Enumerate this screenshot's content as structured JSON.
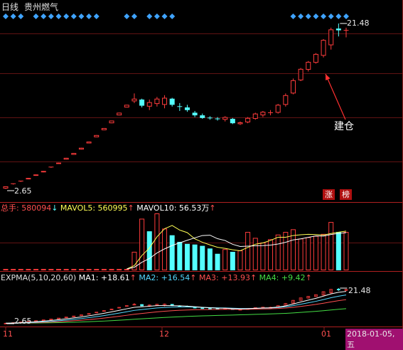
{
  "header": {
    "period": "日线",
    "stock_name": "贵州燃气"
  },
  "price_panel": {
    "high_label": "21.48",
    "low_label": "2.65",
    "annotation": "建仓",
    "badges": [
      "涨",
      "榜"
    ]
  },
  "volume_panel": {
    "label_main": "总手: 580094",
    "arrow_main": "↓",
    "mavol5": "MAVOL5: 560995",
    "arrow_mavol5": "↑",
    "mavol10": "MAVOL10: 56.53万",
    "arrow_mavol10": "↑"
  },
  "expma_panel": {
    "title": "EXPMA(5,10,20,60)",
    "ma1": "MA1: +18.61",
    "ma1_arrow": "↑",
    "ma2": "MA2: +16.54",
    "ma2_arrow": "↑",
    "ma3": "MA3: +13.93",
    "ma3_arrow": "↑",
    "ma4": "MA4: +9.42",
    "ma4_arrow": "↑",
    "high_label": "21.48",
    "low_label": "2.65"
  },
  "x_axis": {
    "labels": [
      "11",
      "12",
      "01"
    ],
    "current_date": "2018-01-05,五"
  },
  "colors": {
    "up": "#ff3c3c",
    "down": "#54ffff",
    "grid": "#8a1b1b",
    "diamond": "#3fa3ff",
    "white_line": "#ffffff",
    "yellow_line": "#ffff55",
    "mavol5": "#ffff55",
    "mavol10": "#ffffff",
    "ma1": "#ffffff",
    "ma2": "#54d8ff",
    "ma3": "#ff5050",
    "ma4": "#44dd44"
  },
  "chart_data": {
    "type": "candlestick",
    "price_range": [
      2.65,
      21.48
    ],
    "candles": [
      {
        "o": 2.65,
        "h": 2.9,
        "l": 2.6,
        "c": 2.9,
        "up": true
      },
      {
        "o": 3.1,
        "h": 3.2,
        "l": 3.1,
        "c": 3.2,
        "up": true
      },
      {
        "o": 3.4,
        "h": 3.5,
        "l": 3.4,
        "c": 3.5,
        "up": true
      },
      {
        "o": 3.7,
        "h": 3.85,
        "l": 3.7,
        "c": 3.85,
        "up": true
      },
      {
        "o": 4.1,
        "h": 4.25,
        "l": 4.1,
        "c": 4.25,
        "up": true
      },
      {
        "o": 4.5,
        "h": 4.65,
        "l": 4.5,
        "c": 4.65,
        "up": true
      },
      {
        "o": 5.0,
        "h": 5.1,
        "l": 5.0,
        "c": 5.1,
        "up": true
      },
      {
        "o": 5.45,
        "h": 5.6,
        "l": 5.45,
        "c": 5.6,
        "up": true
      },
      {
        "o": 5.95,
        "h": 6.15,
        "l": 5.95,
        "c": 6.15,
        "up": true
      },
      {
        "o": 6.5,
        "h": 6.7,
        "l": 6.5,
        "c": 6.7,
        "up": true
      },
      {
        "o": 7.1,
        "h": 7.3,
        "l": 7.1,
        "c": 7.3,
        "up": true
      },
      {
        "o": 7.8,
        "h": 8.0,
        "l": 7.8,
        "c": 8.0,
        "up": true
      },
      {
        "o": 8.5,
        "h": 8.75,
        "l": 8.5,
        "c": 8.75,
        "up": true
      },
      {
        "o": 9.3,
        "h": 9.55,
        "l": 9.3,
        "c": 9.55,
        "up": true
      },
      {
        "o": 10.1,
        "h": 10.4,
        "l": 10.1,
        "c": 10.4,
        "up": true
      },
      {
        "o": 11.0,
        "h": 11.3,
        "l": 11.0,
        "c": 11.3,
        "up": true
      },
      {
        "o": 11.9,
        "h": 12.2,
        "l": 11.9,
        "c": 12.2,
        "up": true
      },
      {
        "o": 12.6,
        "h": 13.5,
        "l": 12.4,
        "c": 12.9,
        "up": true
      },
      {
        "o": 12.8,
        "h": 12.9,
        "l": 11.9,
        "c": 12.1,
        "up": false
      },
      {
        "o": 12.0,
        "h": 12.8,
        "l": 11.6,
        "c": 12.5,
        "up": true
      },
      {
        "o": 12.3,
        "h": 13.1,
        "l": 12.0,
        "c": 12.9,
        "up": true
      },
      {
        "o": 13.0,
        "h": 13.3,
        "l": 11.8,
        "c": 12.2,
        "up": true
      },
      {
        "o": 12.9,
        "h": 13.0,
        "l": 12.0,
        "c": 12.2,
        "up": false
      },
      {
        "o": 12.0,
        "h": 12.4,
        "l": 11.5,
        "c": 11.9,
        "up": false
      },
      {
        "o": 11.9,
        "h": 12.2,
        "l": 11.4,
        "c": 11.6,
        "up": false
      },
      {
        "o": 11.3,
        "h": 11.5,
        "l": 10.8,
        "c": 11.0,
        "up": false
      },
      {
        "o": 11.0,
        "h": 11.2,
        "l": 10.6,
        "c": 10.7,
        "up": false
      },
      {
        "o": 10.7,
        "h": 10.9,
        "l": 10.5,
        "c": 10.6,
        "up": false
      },
      {
        "o": 10.6,
        "h": 10.8,
        "l": 10.4,
        "c": 10.5,
        "up": false
      },
      {
        "o": 10.5,
        "h": 10.9,
        "l": 10.3,
        "c": 10.8,
        "up": true
      },
      {
        "o": 10.6,
        "h": 10.7,
        "l": 10.0,
        "c": 10.1,
        "up": false
      },
      {
        "o": 10.0,
        "h": 10.3,
        "l": 9.9,
        "c": 10.2,
        "up": true
      },
      {
        "o": 10.2,
        "h": 10.8,
        "l": 10.1,
        "c": 10.7,
        "up": true
      },
      {
        "o": 10.6,
        "h": 11.3,
        "l": 10.5,
        "c": 11.2,
        "up": true
      },
      {
        "o": 11.0,
        "h": 11.5,
        "l": 10.8,
        "c": 11.4,
        "up": true
      },
      {
        "o": 11.2,
        "h": 11.6,
        "l": 11.0,
        "c": 11.3,
        "up": true
      },
      {
        "o": 11.3,
        "h": 12.3,
        "l": 11.2,
        "c": 12.2,
        "up": true
      },
      {
        "o": 12.2,
        "h": 13.5,
        "l": 12.0,
        "c": 13.3,
        "up": true
      },
      {
        "o": 13.5,
        "h": 15.2,
        "l": 13.4,
        "c": 15.0,
        "up": true
      },
      {
        "o": 15.0,
        "h": 16.4,
        "l": 14.9,
        "c": 16.3,
        "up": true
      },
      {
        "o": 16.2,
        "h": 17.2,
        "l": 16.0,
        "c": 17.1,
        "up": true
      },
      {
        "o": 17.0,
        "h": 18.1,
        "l": 16.9,
        "c": 18.0,
        "up": true
      },
      {
        "o": 17.8,
        "h": 19.7,
        "l": 17.6,
        "c": 19.6,
        "up": true
      },
      {
        "o": 19.0,
        "h": 21.0,
        "l": 18.5,
        "c": 20.8,
        "up": true
      },
      {
        "o": 20.7,
        "h": 21.48,
        "l": 20.0,
        "c": 20.9,
        "up": false
      },
      {
        "o": 20.6,
        "h": 21.0,
        "l": 19.9,
        "c": 20.7,
        "up": true
      }
    ],
    "volume": [
      {
        "v": 2,
        "up": true
      },
      {
        "v": 2,
        "up": true
      },
      {
        "v": 2,
        "up": true
      },
      {
        "v": 2,
        "up": true
      },
      {
        "v": 2,
        "up": true
      },
      {
        "v": 2,
        "up": true
      },
      {
        "v": 2,
        "up": true
      },
      {
        "v": 2,
        "up": true
      },
      {
        "v": 2,
        "up": true
      },
      {
        "v": 2,
        "up": true
      },
      {
        "v": 2,
        "up": true
      },
      {
        "v": 2,
        "up": true
      },
      {
        "v": 2,
        "up": true
      },
      {
        "v": 2,
        "up": true
      },
      {
        "v": 2,
        "up": true
      },
      {
        "v": 2,
        "up": true
      },
      {
        "v": 2,
        "up": true
      },
      {
        "v": 28,
        "up": true
      },
      {
        "v": 78,
        "up": true
      },
      {
        "v": 59,
        "up": false
      },
      {
        "v": 86,
        "up": true
      },
      {
        "v": 63,
        "up": true
      },
      {
        "v": 53,
        "up": false
      },
      {
        "v": 43,
        "up": false
      },
      {
        "v": 40,
        "up": false
      },
      {
        "v": 39,
        "up": false
      },
      {
        "v": 37,
        "up": false
      },
      {
        "v": 33,
        "up": false
      },
      {
        "v": 25,
        "up": false
      },
      {
        "v": 32,
        "up": true
      },
      {
        "v": 28,
        "up": false
      },
      {
        "v": 30,
        "up": true
      },
      {
        "v": 58,
        "up": true
      },
      {
        "v": 49,
        "up": true
      },
      {
        "v": 42,
        "up": true
      },
      {
        "v": 47,
        "up": true
      },
      {
        "v": 54,
        "up": true
      },
      {
        "v": 58,
        "up": true
      },
      {
        "v": 62,
        "up": true
      },
      {
        "v": 48,
        "up": true
      },
      {
        "v": 50,
        "up": true
      },
      {
        "v": 52,
        "up": true
      },
      {
        "v": 55,
        "up": true
      },
      {
        "v": 73,
        "up": true
      },
      {
        "v": 58,
        "up": false
      },
      {
        "v": 58,
        "up": true
      }
    ]
  }
}
